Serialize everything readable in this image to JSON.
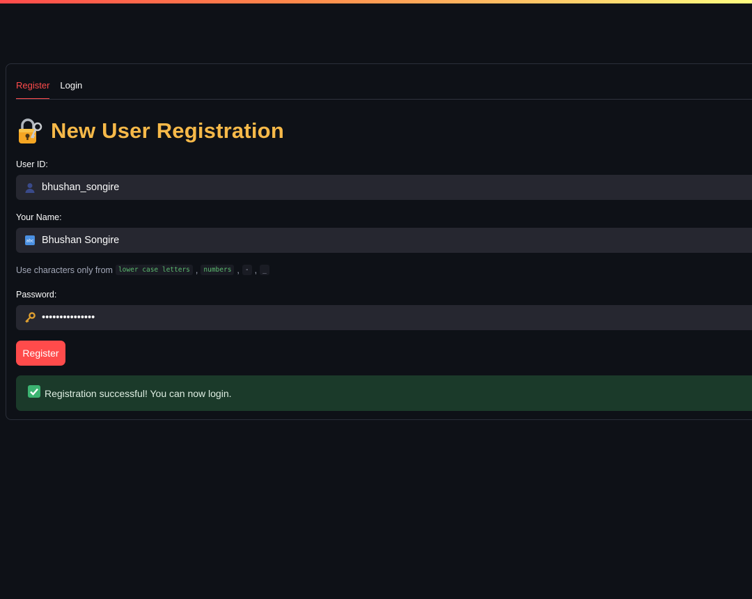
{
  "tabs": [
    {
      "label": "Register",
      "active": true
    },
    {
      "label": "Login",
      "active": false
    }
  ],
  "header": {
    "icon": "lock-with-key-icon",
    "title": "New User Registration",
    "title_color": "#f6b949"
  },
  "form": {
    "user_id": {
      "label": "User ID:",
      "value": "bhushan_songire",
      "icon": "person-icon"
    },
    "name": {
      "label": "Your Name:",
      "value": "Bhushan Songire",
      "icon": "abc-icon"
    },
    "hint": {
      "prefix": "Use characters only from",
      "tokens": [
        "lower case letters",
        "numbers",
        "-",
        "_"
      ],
      "separator": ","
    },
    "password": {
      "label": "Password:",
      "value": "•••••••••••••••",
      "icon": "key-icon"
    },
    "submit_label": "Register"
  },
  "alert": {
    "icon": "check-mark-icon",
    "text": "Registration successful! You can now login.",
    "color": "#1b3a2a"
  },
  "accent_color": "#ff4b4b"
}
